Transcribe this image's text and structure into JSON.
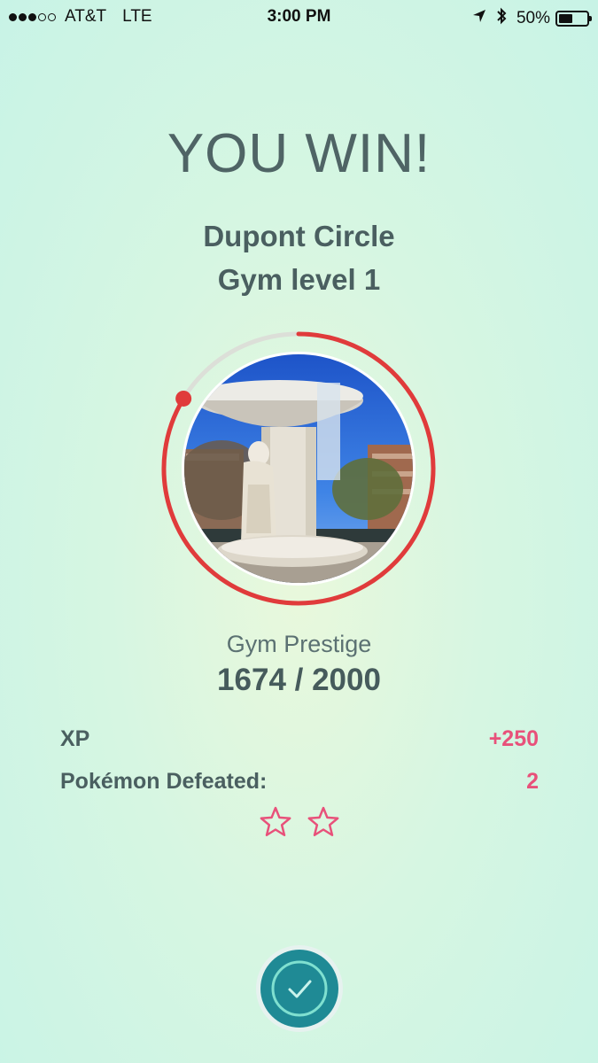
{
  "status_bar": {
    "carrier": "AT&T",
    "network": "LTE",
    "time": "3:00 PM",
    "battery": "50%",
    "battery_level": 0.5,
    "signal_bars": 3,
    "signal_total": 5
  },
  "result": {
    "title": "YOU WIN!",
    "gym_name": "Dupont Circle",
    "gym_level": "Gym level 1"
  },
  "prestige": {
    "label": "Gym Prestige",
    "value": "1674 / 2000",
    "current": 1674,
    "max": 2000
  },
  "stats": {
    "xp_label": "XP",
    "xp_value": "+250",
    "defeated_label": "Pokémon Defeated:",
    "defeated_value": "2"
  },
  "stars": {
    "count": 2
  },
  "colors": {
    "accent_red": "#e03b3b",
    "accent_pink": "#e8517a",
    "button_teal": "#1f8a95"
  },
  "icons": {
    "check": "check-icon",
    "star": "star-outline-icon",
    "location": "location-arrow-icon",
    "bluetooth": "bluetooth-icon"
  }
}
